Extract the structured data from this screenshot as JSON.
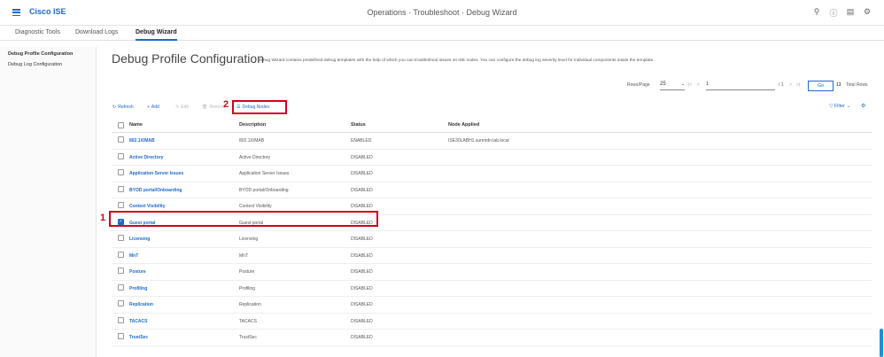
{
  "header": {
    "brand": "Cisco ISE",
    "breadcrumb": "Operations · Troubleshoot · Debug Wizard",
    "icons": [
      "search-icon",
      "help-icon",
      "dashboard-icon",
      "gear-icon"
    ]
  },
  "tabs": [
    "Diagnostic Tools",
    "Download Logs",
    "Debug Wizard"
  ],
  "sidebar": [
    "Debug Profile Configuration",
    "Debug Log Configuration"
  ],
  "page": {
    "title": "Debug Profile Configuration",
    "description": "Debug Wizard contains predefined debug templates with the help of which you can troubleshoot issues on ISE nodes. You can configure the debug log severity level for individual components inside the template."
  },
  "pagination": {
    "rows_label": "Rows/Page",
    "rows_value": "25",
    "page_value": "1",
    "of_pages": "/ 1",
    "go": "Go",
    "total": "13",
    "total_label": "Total Rows"
  },
  "toolbar": {
    "refresh": "Refresh",
    "add": "Add",
    "edit": "Edit",
    "remove": "Remove",
    "debug_nodes": "Debug Nodes",
    "filter": "Filter"
  },
  "table": {
    "headers": [
      "Name",
      "Description",
      "Status",
      "Node Applied"
    ],
    "rows": [
      {
        "name": "802.1X/MAB",
        "desc": "802.1X/MAB",
        "status": "ENABLED",
        "node": "ISE30LABH1.surendn.lab.local",
        "checked": false
      },
      {
        "name": "Active Directory",
        "desc": "Active Directory",
        "status": "DISABLED",
        "node": "",
        "checked": false
      },
      {
        "name": "Application Server Issues",
        "desc": "Application Server Issues",
        "status": "DISABLED",
        "node": "",
        "checked": false
      },
      {
        "name": "BYOD portal/Onboarding",
        "desc": "BYOD portal/Onboarding",
        "status": "DISABLED",
        "node": "",
        "checked": false
      },
      {
        "name": "Context Visibility",
        "desc": "Context Visibility",
        "status": "DISABLED",
        "node": "",
        "checked": false
      },
      {
        "name": "Guest portal",
        "desc": "Guest portal",
        "status": "DISABLED",
        "node": "",
        "checked": true
      },
      {
        "name": "Licensing",
        "desc": "Licensing",
        "status": "DISABLED",
        "node": "",
        "checked": false
      },
      {
        "name": "MnT",
        "desc": "MnT",
        "status": "DISABLED",
        "node": "",
        "checked": false
      },
      {
        "name": "Posture",
        "desc": "Posture",
        "status": "DISABLED",
        "node": "",
        "checked": false
      },
      {
        "name": "Profiling",
        "desc": "Profiling",
        "status": "DISABLED",
        "node": "",
        "checked": false
      },
      {
        "name": "Replication",
        "desc": "Replication",
        "status": "DISABLED",
        "node": "",
        "checked": false
      },
      {
        "name": "TACACS",
        "desc": "TACACS",
        "status": "DISABLED",
        "node": "",
        "checked": false
      },
      {
        "name": "TrustSec",
        "desc": "TrustSec",
        "status": "DISABLED",
        "node": "",
        "checked": false
      }
    ]
  },
  "annotations": [
    "1",
    "2"
  ],
  "colors": {
    "accent": "#1d69cc",
    "highlight": "#d0021b"
  }
}
